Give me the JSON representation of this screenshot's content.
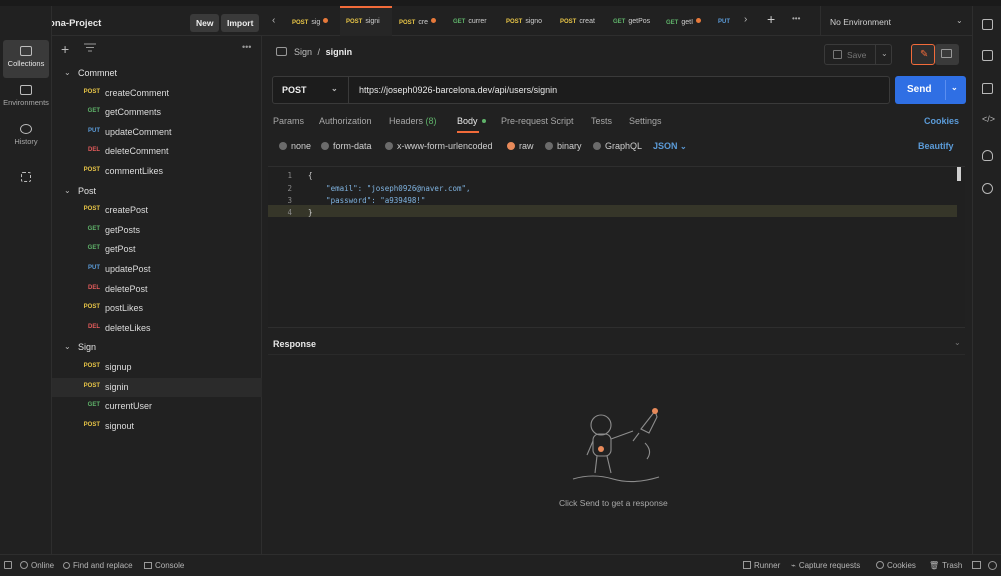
{
  "workspace": {
    "name": "Barcelona-Project",
    "new_label": "New",
    "import_label": "Import"
  },
  "rail": [
    {
      "label": "Collections",
      "icon": "collections-icon"
    },
    {
      "label": "Environments",
      "icon": "environments-icon"
    },
    {
      "label": "History",
      "icon": "history-icon"
    },
    {
      "label": "",
      "icon": "apps-icon"
    }
  ],
  "tree": [
    {
      "type": "folder",
      "name": "Commnet"
    },
    {
      "type": "req",
      "method": "POST",
      "name": "createComment"
    },
    {
      "type": "req",
      "method": "GET",
      "name": "getComments"
    },
    {
      "type": "req",
      "method": "PUT",
      "name": "updateComment"
    },
    {
      "type": "req",
      "method": "DEL",
      "name": "deleteComment"
    },
    {
      "type": "req",
      "method": "POST",
      "name": "commentLikes"
    },
    {
      "type": "folder",
      "name": "Post"
    },
    {
      "type": "req",
      "method": "POST",
      "name": "createPost"
    },
    {
      "type": "req",
      "method": "GET",
      "name": "getPosts"
    },
    {
      "type": "req",
      "method": "GET",
      "name": "getPost"
    },
    {
      "type": "req",
      "method": "PUT",
      "name": "updatePost"
    },
    {
      "type": "req",
      "method": "DEL",
      "name": "deletePost"
    },
    {
      "type": "req",
      "method": "POST",
      "name": "postLikes"
    },
    {
      "type": "req",
      "method": "DEL",
      "name": "deleteLikes"
    },
    {
      "type": "folder",
      "name": "Sign"
    },
    {
      "type": "req",
      "method": "POST",
      "name": "signup"
    },
    {
      "type": "req",
      "method": "POST",
      "name": "signin"
    },
    {
      "type": "req",
      "method": "GET",
      "name": "currentUser"
    },
    {
      "type": "req",
      "method": "POST",
      "name": "signout"
    }
  ],
  "tabs": [
    {
      "method": "POST",
      "label": "sig",
      "dot": true
    },
    {
      "method": "POST",
      "label": "signi",
      "dot": false
    },
    {
      "method": "POST",
      "label": "cre",
      "dot": true
    },
    {
      "method": "GET",
      "label": "currer",
      "dot": false
    },
    {
      "method": "POST",
      "label": "signo",
      "dot": false
    },
    {
      "method": "POST",
      "label": "creat",
      "dot": false
    },
    {
      "method": "GET",
      "label": "getPos",
      "dot": false
    },
    {
      "method": "GET",
      "label": "getI",
      "dot": true
    },
    {
      "method": "PUT",
      "label": "",
      "dot": false
    }
  ],
  "environment": "No Environment",
  "breadcrumb": {
    "folder": "Sign",
    "sep": "/",
    "request": "signin"
  },
  "save_label": "Save",
  "request": {
    "method": "POST",
    "url": "https://joseph0926-barcelona.dev/api/users/signin",
    "send_label": "Send"
  },
  "subtabs": [
    "Params",
    "Authorization",
    "Headers",
    "Body",
    "Pre-request Script",
    "Tests",
    "Settings"
  ],
  "headers_count": "(8)",
  "cookies_label": "Cookies",
  "body_types": [
    "none",
    "form-data",
    "x-www-form-urlencoded",
    "raw",
    "binary",
    "GraphQL"
  ],
  "body_format": "JSON",
  "beautify_label": "Beautify",
  "code_lines": [
    "{",
    "    \"email\": \"joseph0926@naver.com\",",
    "    \"password\": \"a939498!\"",
    "}"
  ],
  "line_numbers": [
    "1",
    "2",
    "3",
    "4"
  ],
  "response": {
    "title": "Response",
    "empty_text": "Click Send to get a response"
  },
  "statusbar": {
    "online": "Online",
    "find": "Find and replace",
    "console": "Console",
    "runner": "Runner",
    "capture": "Capture requests",
    "cookies": "Cookies",
    "trash": "Trash"
  },
  "colors": {
    "post": "#e8c547",
    "get": "#5fb36a",
    "put": "#5b9bd8",
    "del": "#e25b5b",
    "accent": "#f26b3a",
    "send": "#2f6fe4"
  }
}
